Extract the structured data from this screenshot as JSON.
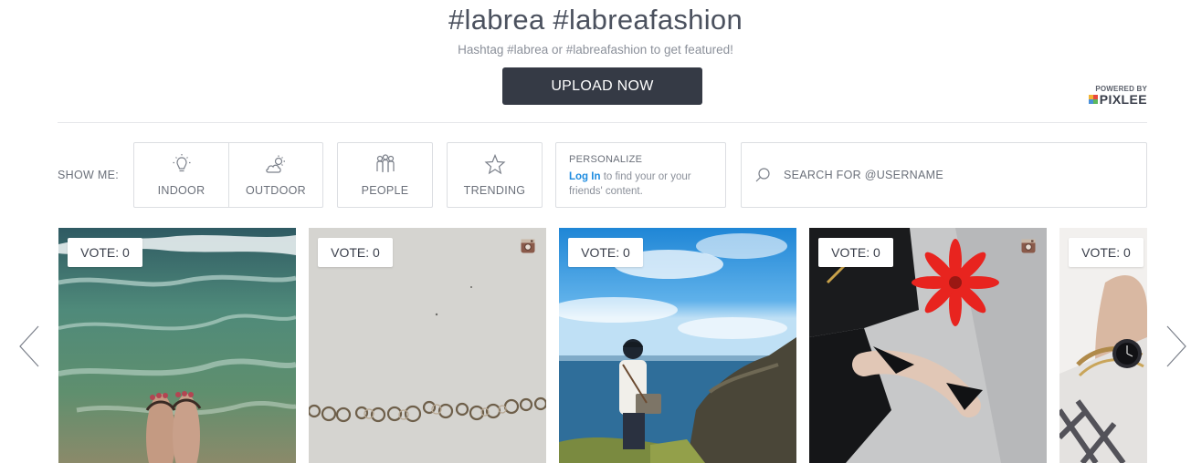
{
  "header": {
    "title": "#labrea  #labreafashion",
    "subtitle": "Hashtag #labrea or #labreafashion to get featured!",
    "upload_label": "UPLOAD NOW",
    "powered_by": "POWERED BY",
    "powered_brand": "PIXLEE"
  },
  "filters": {
    "show_me_label": "SHOW ME:",
    "items": [
      {
        "label": "INDOOR",
        "icon": "lightbulb-icon"
      },
      {
        "label": "OUTDOOR",
        "icon": "partly-cloudy-icon"
      },
      {
        "label": "PEOPLE",
        "icon": "people-icon"
      },
      {
        "label": "TRENDING",
        "icon": "star-icon"
      }
    ]
  },
  "personalize": {
    "title": "PERSONALIZE",
    "link": "Log In",
    "text": " to find your or your friends' content."
  },
  "search": {
    "placeholder": "SEARCH FOR @USERNAME"
  },
  "gallery": {
    "cards": [
      {
        "vote": "VOTE: 0",
        "instagram": false
      },
      {
        "vote": "VOTE: 0",
        "instagram": true
      },
      {
        "vote": "VOTE: 0",
        "instagram": false
      },
      {
        "vote": "VOTE: 0",
        "instagram": true
      },
      {
        "vote": "VOTE: 0",
        "instagram": false
      }
    ]
  },
  "colors": {
    "button_bg": "#353a45",
    "link": "#1e8ce0",
    "border": "#dcdee2",
    "text": "#6b707a"
  }
}
